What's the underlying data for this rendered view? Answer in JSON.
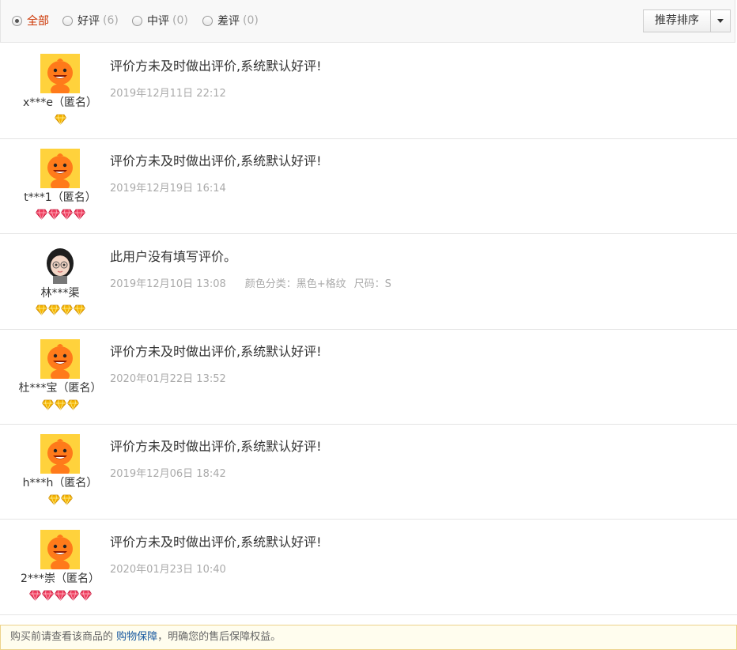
{
  "filters": [
    {
      "label": "全部",
      "count": "",
      "checked": true
    },
    {
      "label": "好评",
      "count": "(6)",
      "checked": false
    },
    {
      "label": "中评",
      "count": "(0)",
      "checked": false
    },
    {
      "label": "差评",
      "count": "(0)",
      "checked": false
    }
  ],
  "sort": {
    "label": "推荐排序"
  },
  "reviews": [
    {
      "user": "x***e（匿名）",
      "avatar": "mascot-avatar",
      "badge_type": "gold-diamond",
      "badge_count": 1,
      "content": "评价方未及时做出评价,系统默认好评!",
      "date": "2019年12月11日 22:12",
      "sku_color": "",
      "sku_size": ""
    },
    {
      "user": "t***1（匿名）",
      "avatar": "mascot-avatar",
      "badge_type": "red-heart",
      "badge_count": 4,
      "content": "评价方未及时做出评价,系统默认好评!",
      "date": "2019年12月19日 16:14",
      "sku_color": "",
      "sku_size": ""
    },
    {
      "user": "林***渠",
      "avatar": "girl-avatar",
      "badge_type": "gold-diamond",
      "badge_count": 4,
      "content": "此用户没有填写评价。",
      "date": "2019年12月10日 13:08",
      "sku_color": "颜色分类：黑色+格纹",
      "sku_size": "尺码：S"
    },
    {
      "user": "杜***宝（匿名）",
      "avatar": "mascot-avatar",
      "badge_type": "gold-diamond",
      "badge_count": 3,
      "content": "评价方未及时做出评价,系统默认好评!",
      "date": "2020年01月22日 13:52",
      "sku_color": "",
      "sku_size": ""
    },
    {
      "user": "h***h（匿名）",
      "avatar": "mascot-avatar",
      "badge_type": "gold-diamond",
      "badge_count": 2,
      "content": "评价方未及时做出评价,系统默认好评!",
      "date": "2019年12月06日 18:42",
      "sku_color": "",
      "sku_size": ""
    },
    {
      "user": "2***崇（匿名）",
      "avatar": "mascot-avatar",
      "badge_type": "red-heart",
      "badge_count": 5,
      "content": "评价方未及时做出评价,系统默认好评!",
      "date": "2020年01月23日 10:40",
      "sku_color": "",
      "sku_size": ""
    }
  ],
  "notice": {
    "prefix": "购买前请查看该商品的 ",
    "link": "购物保障",
    "suffix": "，明确您的售后保障权益。"
  },
  "colors": {
    "active": "#cc3300",
    "link": "#1a5aa0",
    "mascot": "#ff7a1a",
    "mascot_bg": "#ffd23c"
  }
}
